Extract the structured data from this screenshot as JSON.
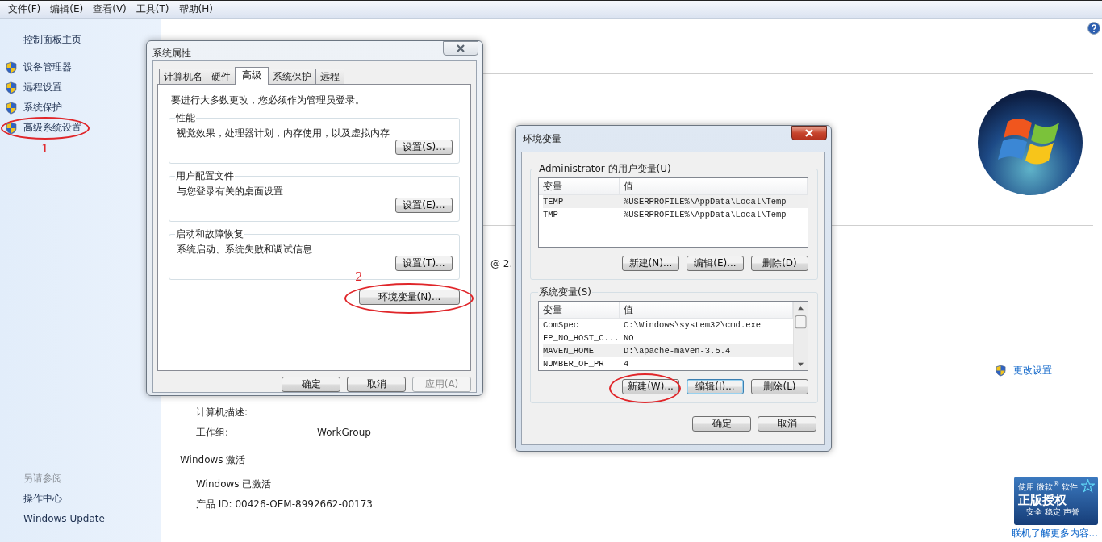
{
  "menu_bar": [
    "文件(F)",
    "编辑(E)",
    "查看(V)",
    "工具(T)",
    "帮助(H)"
  ],
  "sidebar": {
    "home": "控制面板主页",
    "tasks": [
      {
        "label": "设备管理器",
        "circled": false
      },
      {
        "label": "远程设置",
        "circled": false
      },
      {
        "label": "系统保护",
        "circled": false
      },
      {
        "label": "高级系统设置",
        "circled": true,
        "marker": "1"
      }
    ],
    "see_also_title": "另请参阅",
    "see_also": [
      "操作中心",
      "Windows Update"
    ]
  },
  "main": {
    "processor_fragment": "@ 2.",
    "change_settings": "更改设置",
    "computer_description_label": "计算机描述:",
    "workgroup_label": "工作组:",
    "workgroup_value": "WorkGroup",
    "activation_title": "Windows 激活",
    "activation_status": "Windows 已激活",
    "product_id": "产品 ID: 00426-OEM-8992662-00173",
    "genuine_badge": {
      "top_small": "使用",
      "top_brand": "微软$^{®}$",
      "top_word": "软件",
      "title": "正版授权",
      "subtitle": "安全 稳定 声誉"
    },
    "learn_more": "联机了解更多内容..."
  },
  "system_properties": {
    "title": "系统属性",
    "active": false,
    "tabs": [
      {
        "label": "计算机名",
        "selected": false
      },
      {
        "label": "硬件",
        "selected": false
      },
      {
        "label": "高级",
        "selected": true
      },
      {
        "label": "系统保护",
        "selected": false
      },
      {
        "label": "远程",
        "selected": false
      }
    ],
    "admin_note": "要进行大多数更改，您必须作为管理员登录。",
    "groups": [
      {
        "title": "性能",
        "description": "视觉效果，处理器计划，内存使用，以及虚拟内存",
        "button": "设置(S)..."
      },
      {
        "title": "用户配置文件",
        "description": "与您登录有关的桌面设置",
        "button": "设置(E)..."
      },
      {
        "title": "启动和故障恢复",
        "description": "系统启动、系统失败和调试信息",
        "button": "设置(T)..."
      }
    ],
    "env_button": {
      "label": "环境变量(N)...",
      "circled": true,
      "marker": "2"
    },
    "buttons": [
      {
        "label": "确定",
        "disabled": false
      },
      {
        "label": "取消",
        "disabled": false
      },
      {
        "label": "应用(A)",
        "disabled": true
      }
    ]
  },
  "environment_variables": {
    "title": "环境变量",
    "active": true,
    "user_group": {
      "title": "Administrator 的用户变量(U)",
      "columns": [
        "变量",
        "值"
      ],
      "rows": [
        {
          "cells": [
            "TEMP",
            "%USERPROFILE%\\AppData\\Local\\Temp"
          ],
          "selected": true
        },
        {
          "cells": [
            "TMP",
            "%USERPROFILE%\\AppData\\Local\\Temp"
          ],
          "selected": false
        }
      ],
      "buttons": [
        {
          "label": "新建(N)...",
          "focused": false,
          "circled": false
        },
        {
          "label": "编辑(E)...",
          "focused": false,
          "circled": false
        },
        {
          "label": "删除(D)",
          "focused": false,
          "circled": false
        }
      ]
    },
    "system_group": {
      "title": "系统变量(S)",
      "columns": [
        "变量",
        "值"
      ],
      "rows": [
        {
          "cells": [
            "ComSpec",
            "C:\\Windows\\system32\\cmd.exe"
          ],
          "selected": false
        },
        {
          "cells": [
            "FP_NO_HOST_C...",
            "NO"
          ],
          "selected": false
        },
        {
          "cells": [
            "MAVEN_HOME",
            "D:\\apache-maven-3.5.4"
          ],
          "selected": true
        },
        {
          "cells": [
            "NUMBER_OF_PR",
            "4"
          ],
          "selected": false
        }
      ],
      "buttons": [
        {
          "label": "新建(W)...",
          "focused": false,
          "circled": true
        },
        {
          "label": "编辑(I)...",
          "focused": true,
          "circled": false
        },
        {
          "label": "删除(L)",
          "focused": false,
          "circled": false
        }
      ]
    },
    "buttons": [
      "确定",
      "取消"
    ]
  }
}
